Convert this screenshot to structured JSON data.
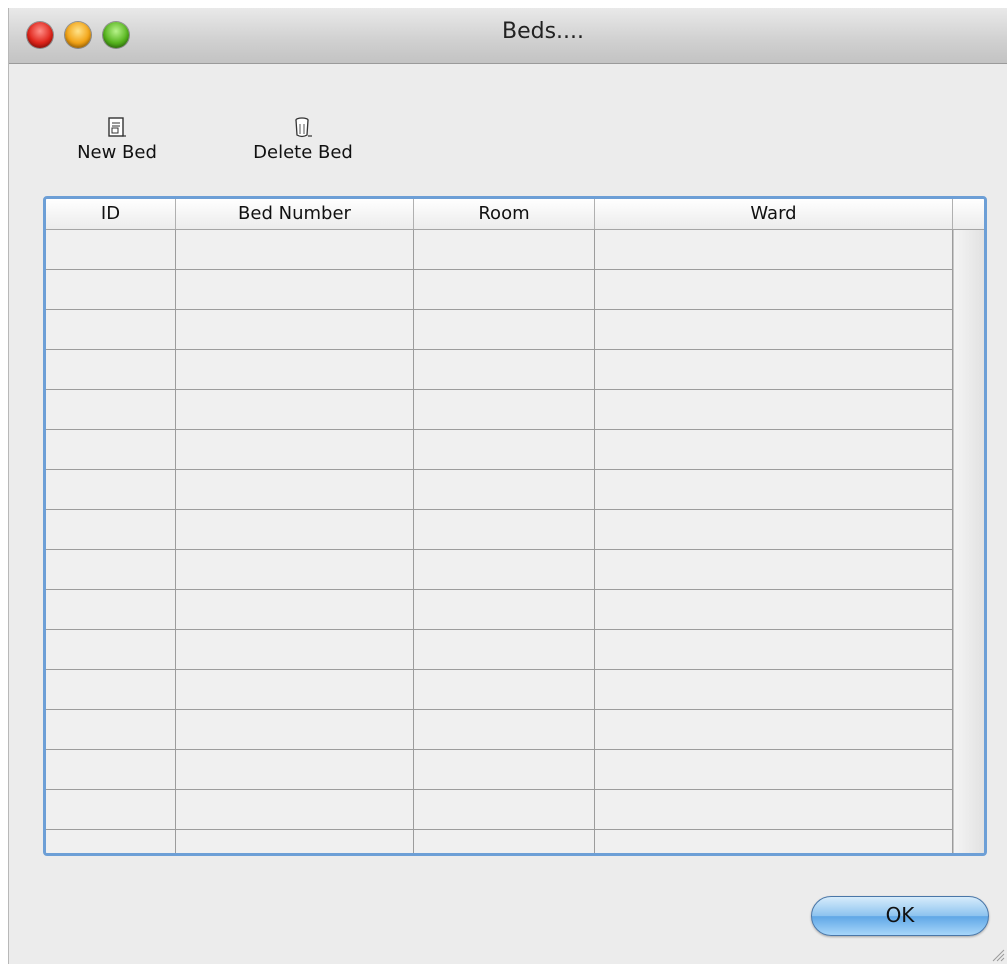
{
  "window": {
    "title": "Beds...."
  },
  "toolbar": {
    "new_bed_label": "New Bed",
    "new_bed_icon": "new-document-icon",
    "delete_bed_label": "Delete Bed",
    "delete_bed_icon": "trash-can-icon"
  },
  "table": {
    "columns": [
      "ID",
      "Bed Number",
      "Room",
      "Ward"
    ],
    "rows": [
      [
        "",
        "",
        "",
        ""
      ],
      [
        "",
        "",
        "",
        ""
      ],
      [
        "",
        "",
        "",
        ""
      ],
      [
        "",
        "",
        "",
        ""
      ],
      [
        "",
        "",
        "",
        ""
      ],
      [
        "",
        "",
        "",
        ""
      ],
      [
        "",
        "",
        "",
        ""
      ],
      [
        "",
        "",
        "",
        ""
      ],
      [
        "",
        "",
        "",
        ""
      ],
      [
        "",
        "",
        "",
        ""
      ],
      [
        "",
        "",
        "",
        ""
      ],
      [
        "",
        "",
        "",
        ""
      ],
      [
        "",
        "",
        "",
        ""
      ],
      [
        "",
        "",
        "",
        ""
      ],
      [
        "",
        "",
        "",
        ""
      ],
      [
        "",
        "",
        "",
        ""
      ]
    ]
  },
  "footer": {
    "ok_label": "OK"
  },
  "colors": {
    "focus_ring": "#6d9fd6",
    "window_bg": "#ececec",
    "ok_button": "#8cc3ef"
  }
}
